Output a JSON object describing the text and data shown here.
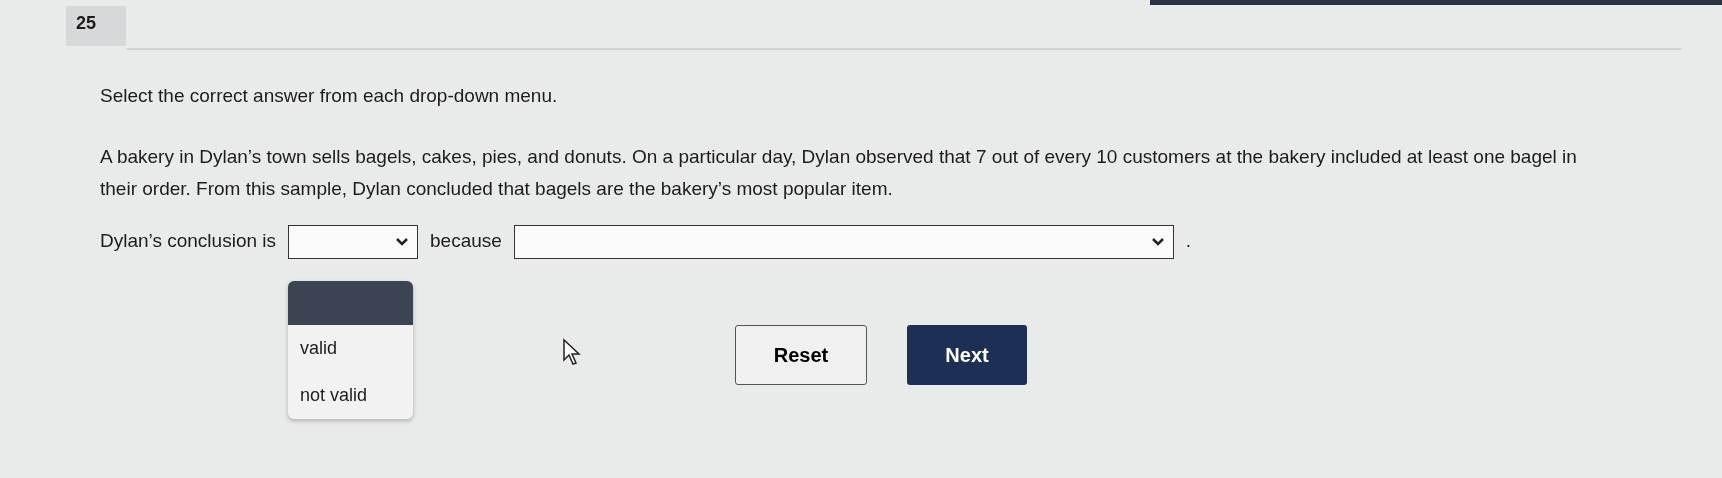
{
  "question_number": "25",
  "instruction": "Select the correct answer from each drop-down menu.",
  "paragraph": "A bakery in Dylan’s town sells bagels, cakes, pies, and donuts. On a particular day, Dylan observed that 7 out of every 10 customers at the bakery included at least one bagel in their order. From this sample, Dylan concluded that bagels are the bakery’s most popular item.",
  "sentence": [
    {
      "kind": "text",
      "text": "Dylan’s conclusion is"
    },
    {
      "kind": "short_dropdown",
      "expanded": true,
      "options": [
        {
          "label": "valid",
          "selected": false
        },
        {
          "label": "not valid",
          "selected": false
        }
      ]
    },
    {
      "kind": "text",
      "text": "because"
    },
    {
      "kind": "long_dropdown"
    },
    {
      "kind": "text",
      "text": "."
    }
  ],
  "buttons": [
    {
      "label": "Reset",
      "kind": "secondary"
    },
    {
      "label": "Next",
      "kind": "primary"
    }
  ]
}
